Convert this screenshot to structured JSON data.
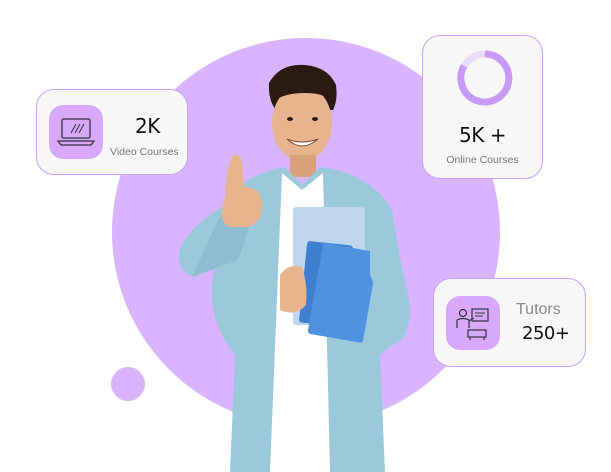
{
  "colors": {
    "accent": "#d8b4fe",
    "icon_bg": "#d8a8ff",
    "card_border": "#c9a2f5",
    "card_bg": "#f7f7f8"
  },
  "cards": {
    "video": {
      "icon": "laptop-icon",
      "value": "2K",
      "label": "Video Courses"
    },
    "online": {
      "icon": "progress-ring-icon",
      "value": "5K +",
      "label": "Online Courses"
    },
    "tutors": {
      "icon": "classroom-board-icon",
      "title": "Tutors",
      "value": "250+"
    }
  }
}
